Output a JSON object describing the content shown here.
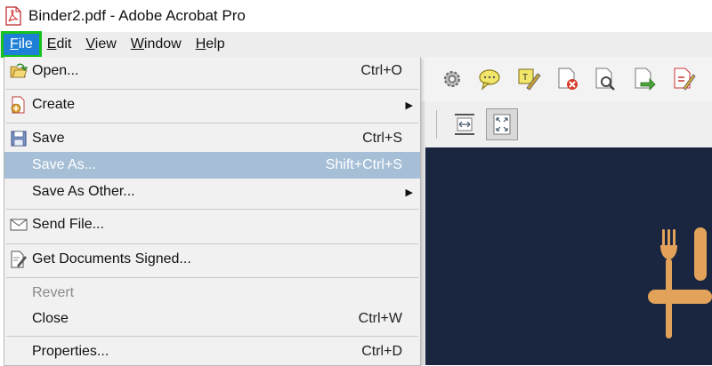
{
  "window": {
    "title": "Binder2.pdf - Adobe Acrobat Pro"
  },
  "menubar": {
    "items": [
      {
        "label": "File",
        "key": "F",
        "rest": "ile"
      },
      {
        "label": "Edit",
        "key": "E",
        "rest": "dit"
      },
      {
        "label": "View",
        "key": "V",
        "rest": "iew"
      },
      {
        "label": "Window",
        "key": "W",
        "rest": "indow"
      },
      {
        "label": "Help",
        "key": "H",
        "rest": "elp"
      }
    ]
  },
  "file_menu": {
    "open": {
      "label": "Open...",
      "shortcut": "Ctrl+O"
    },
    "create": {
      "label": "Create"
    },
    "save": {
      "label": "Save",
      "shortcut": "Ctrl+S"
    },
    "save_as": {
      "label": "Save As...",
      "shortcut": "Shift+Ctrl+S"
    },
    "save_as_other": {
      "label": "Save As Other..."
    },
    "send_file": {
      "label": "Send File..."
    },
    "get_signed": {
      "label": "Get Documents Signed..."
    },
    "revert": {
      "label": "Revert"
    },
    "close": {
      "label": "Close",
      "shortcut": "Ctrl+W"
    },
    "properties": {
      "label": "Properties...",
      "shortcut": "Ctrl+D"
    }
  },
  "colors": {
    "menu_active_bg": "#1e7fd6",
    "highlight_outline": "#16c21e",
    "hover_row": "#a6bfd6",
    "doc_bg": "#1a2640",
    "cutlery": "#e2a25a"
  },
  "icons": [
    "pdf-app-icon",
    "open-folder-icon",
    "create-pdf-icon",
    "save-disk-icon",
    "envelope-icon",
    "sign-document-icon",
    "gear-icon",
    "comment-bubble-icon",
    "fill-sign-icon",
    "pdf-remove-icon",
    "pdf-search-icon",
    "pdf-export-icon",
    "pdf-edit-icon",
    "fit-width-icon",
    "fit-page-icon",
    "fork-knife-icon"
  ]
}
